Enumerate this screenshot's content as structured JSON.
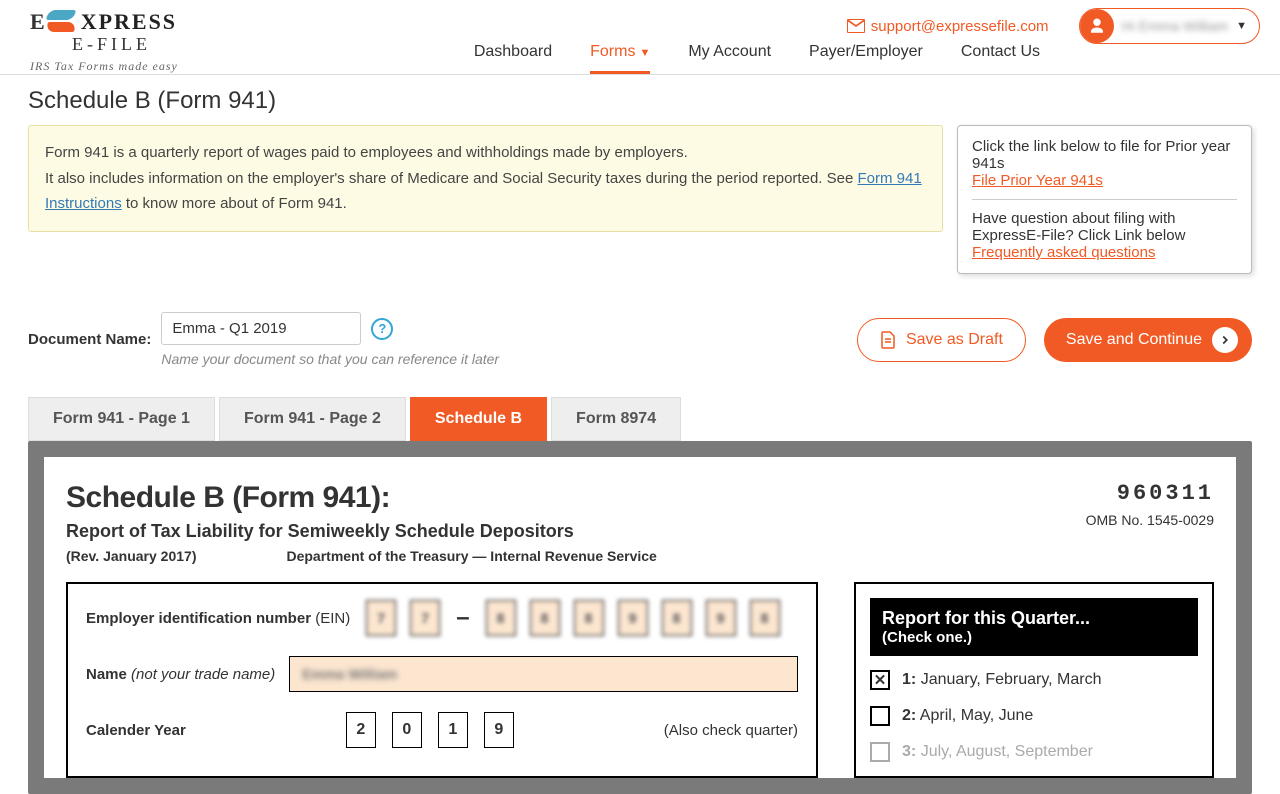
{
  "header": {
    "logo_text": "XPRESS",
    "logo_sub": "E-FILE",
    "tagline": "IRS Tax Forms made easy",
    "support_email": "support@expressefile.com",
    "user_name": "Hi Emma William"
  },
  "nav": {
    "dashboard": "Dashboard",
    "forms": "Forms",
    "account": "My Account",
    "payer": "Payer/Employer",
    "contact": "Contact Us"
  },
  "page": {
    "title": "Schedule B (Form 941)",
    "info_line1": "Form 941 is a quarterly report of wages paid to employees and withholdings made by employers.",
    "info_line2a": "It also includes information on the employer's share of Medicare and Social Security taxes during the period reported. See ",
    "info_link": "Form 941 Instructions",
    "info_line2b": " to know more about of Form 941."
  },
  "sidebar": {
    "prior_text": "Click the link below to file for Prior year 941s",
    "prior_link": "File Prior Year 941s",
    "faq_text": "Have question about filing with ExpressE-File? Click Link below",
    "faq_link": "Frequently asked questions"
  },
  "doc": {
    "label": "Document Name:",
    "value": "Emma - Q1 2019",
    "hint": "Name your document so that you can reference it later",
    "save_draft": "Save as Draft",
    "save_continue": "Save and Continue"
  },
  "tabs": [
    "Form 941 - Page 1",
    "Form 941 - Page 2",
    "Schedule B",
    "Form 8974"
  ],
  "form": {
    "title": "Schedule B (Form 941):",
    "subtitle": "Report of Tax Liability for Semiweekly Schedule Depositors",
    "rev": "(Rev. January 2017)",
    "dept": "Department of the Treasury — Internal Revenue Service",
    "code": "960311",
    "omb": "OMB No. 1545-0029",
    "ein_label": "Employer identification number",
    "ein_suffix": "(EIN)",
    "ein": [
      "7",
      "7",
      "8",
      "8",
      "8",
      "9",
      "8",
      "9",
      "8"
    ],
    "name_label": "Name",
    "name_hint": "(not your trade name)",
    "name_value": "Emma William",
    "year_label": "Calender Year",
    "year": [
      "2",
      "0",
      "1",
      "9"
    ],
    "also_check": "(Also check quarter)",
    "quarter_title": "Report for this Quarter...",
    "quarter_sub": "(Check one.)",
    "quarters": [
      {
        "num": "1:",
        "label": "January, February, March",
        "checked": true
      },
      {
        "num": "2:",
        "label": "April, May, June",
        "checked": false
      },
      {
        "num": "3:",
        "label": "July, August, September",
        "checked": false
      }
    ]
  }
}
